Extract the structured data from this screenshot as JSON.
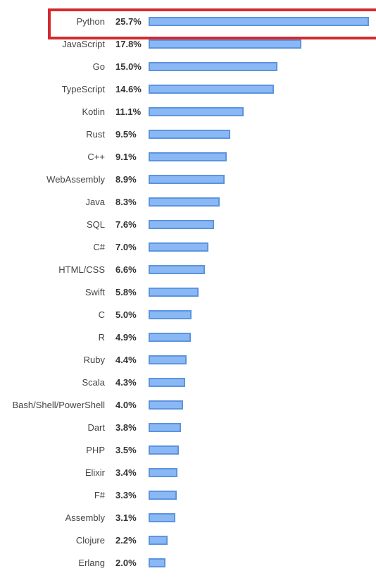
{
  "chart_data": {
    "type": "bar",
    "orientation": "horizontal",
    "title": "",
    "xlabel": "",
    "ylabel": "",
    "xlim": [
      0,
      25.7
    ],
    "grid": false,
    "value_suffix": "%",
    "highlighted_category": "Python",
    "colors": {
      "bar_fill": "#8ab8f5",
      "bar_border": "#5d94de",
      "highlight": "#d42a2f"
    },
    "categories": [
      "Python",
      "JavaScript",
      "Go",
      "TypeScript",
      "Kotlin",
      "Rust",
      "C++",
      "WebAssembly",
      "Java",
      "SQL",
      "C#",
      "HTML/CSS",
      "Swift",
      "C",
      "R",
      "Ruby",
      "Scala",
      "Bash/Shell/PowerShell",
      "Dart",
      "PHP",
      "Elixir",
      "F#",
      "Assembly",
      "Clojure",
      "Erlang"
    ],
    "values": [
      25.7,
      17.8,
      15.0,
      14.6,
      11.1,
      9.5,
      9.1,
      8.9,
      8.3,
      7.6,
      7.0,
      6.6,
      5.8,
      5.0,
      4.9,
      4.4,
      4.3,
      4.0,
      3.8,
      3.5,
      3.4,
      3.3,
      3.1,
      2.2,
      2.0
    ],
    "labels": [
      "25.7%",
      "17.8%",
      "15.0%",
      "14.6%",
      "11.1%",
      "9.5%",
      "9.1%",
      "8.9%",
      "8.3%",
      "7.6%",
      "7.0%",
      "6.6%",
      "5.8%",
      "5.0%",
      "4.9%",
      "4.4%",
      "4.3%",
      "4.0%",
      "3.8%",
      "3.5%",
      "3.4%",
      "3.3%",
      "3.1%",
      "2.2%",
      "2.0%"
    ]
  }
}
